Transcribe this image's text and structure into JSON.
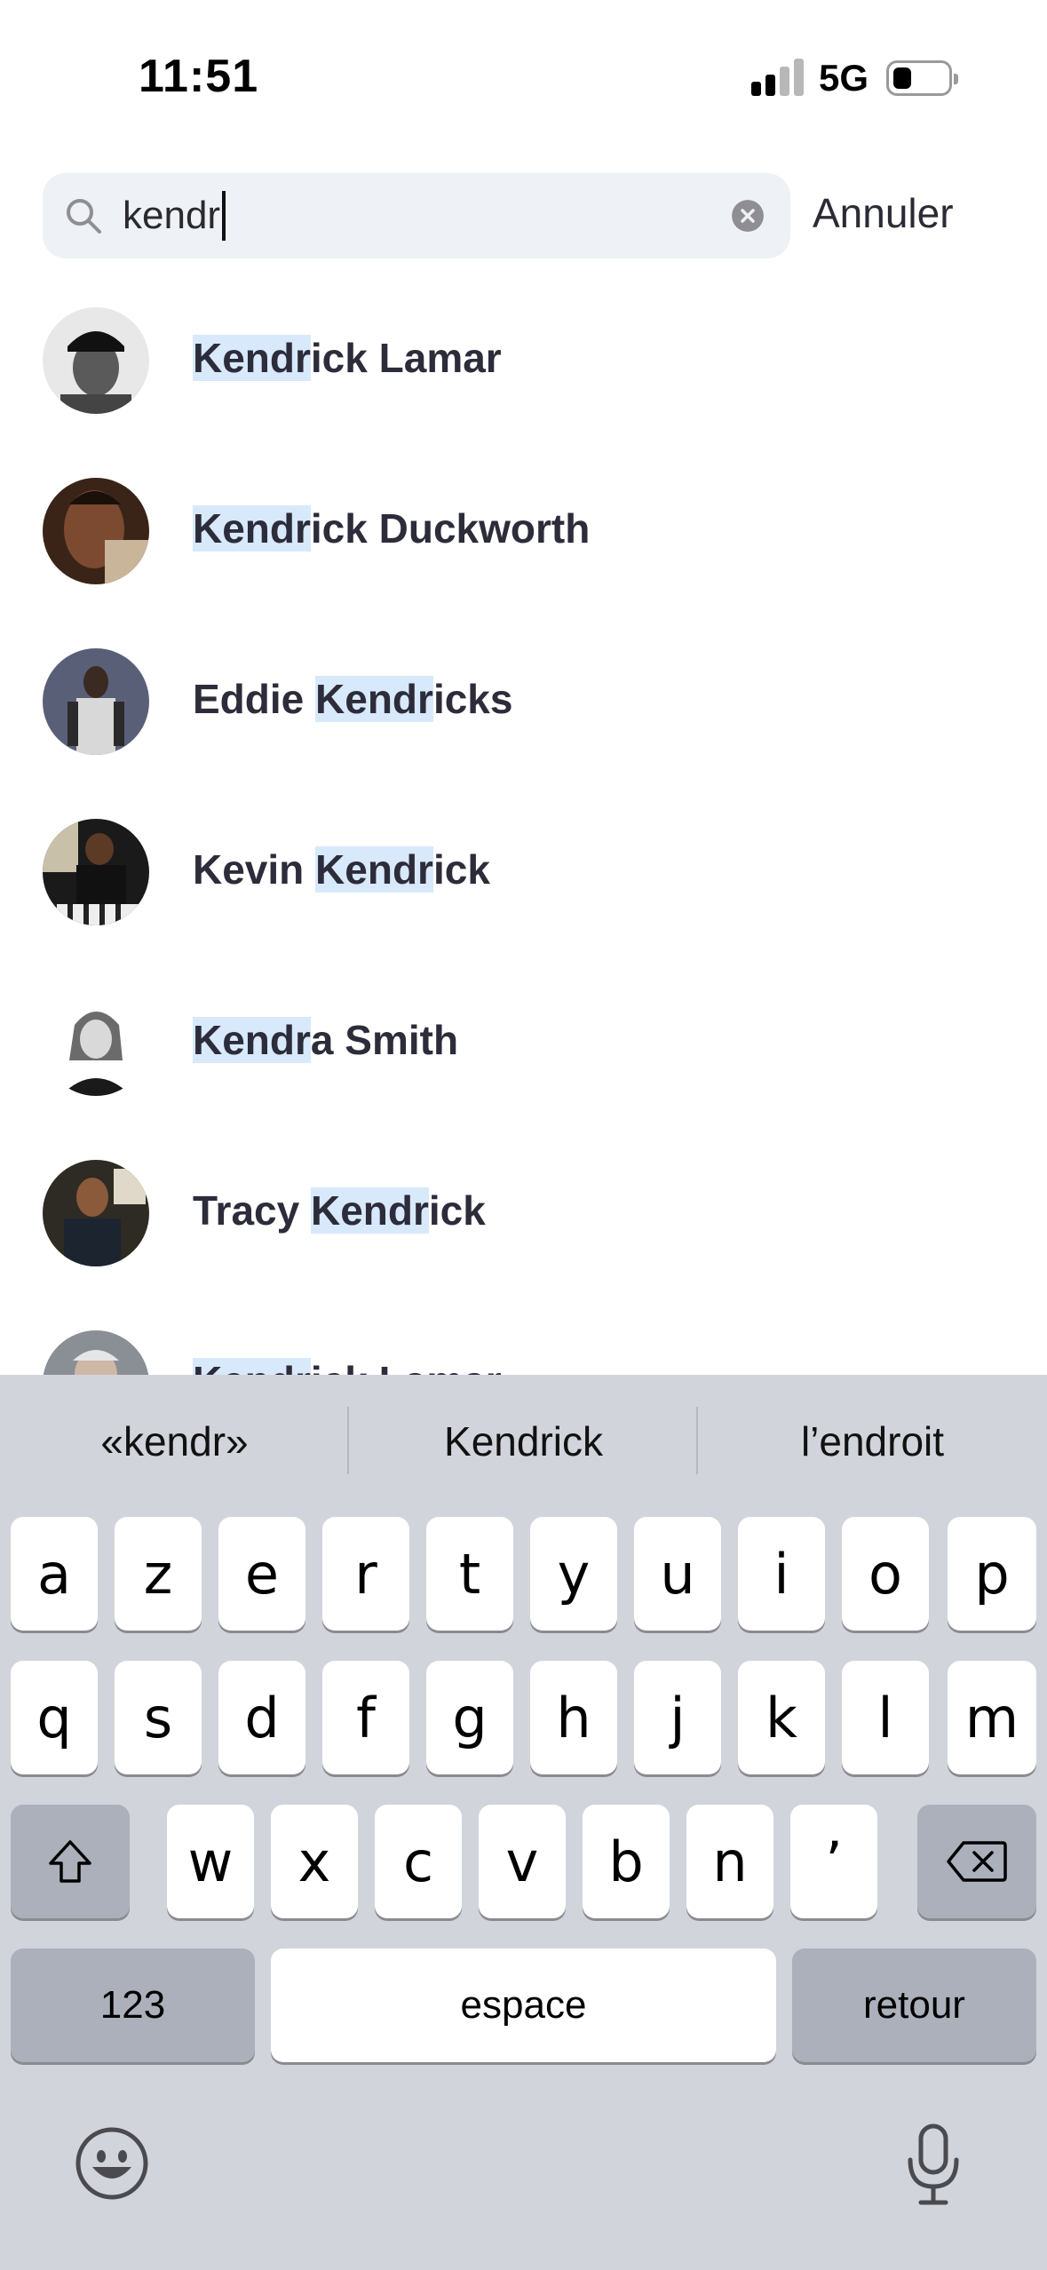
{
  "status_bar": {
    "time": "11:51",
    "network": "5G"
  },
  "search": {
    "query": "kendr",
    "cancel_label": "Annuler"
  },
  "results": [
    {
      "pre": "",
      "hl": "Kendr",
      "post": "ick Lamar"
    },
    {
      "pre": "",
      "hl": "Kendr",
      "post": "ick Duckworth"
    },
    {
      "pre": "Eddie ",
      "hl": "Kendr",
      "post": "icks"
    },
    {
      "pre": "Kevin ",
      "hl": "Kendr",
      "post": "ick"
    },
    {
      "pre": "",
      "hl": "Kendr",
      "post": "a Smith"
    },
    {
      "pre": "Tracy ",
      "hl": "Kendr",
      "post": "ick"
    },
    {
      "pre": "",
      "hl": "Kendr",
      "post": "ick Lamar"
    }
  ],
  "keyboard": {
    "suggestions": [
      "«kendr»",
      "Kendrick",
      "l’endroit"
    ],
    "row1": [
      "a",
      "z",
      "e",
      "r",
      "t",
      "y",
      "u",
      "i",
      "o",
      "p"
    ],
    "row2": [
      "q",
      "s",
      "d",
      "f",
      "g",
      "h",
      "j",
      "k",
      "l",
      "m"
    ],
    "row3": [
      "w",
      "x",
      "c",
      "v",
      "b",
      "n",
      "’"
    ],
    "numbers_label": "123",
    "space_label": "espace",
    "return_label": "retour"
  }
}
